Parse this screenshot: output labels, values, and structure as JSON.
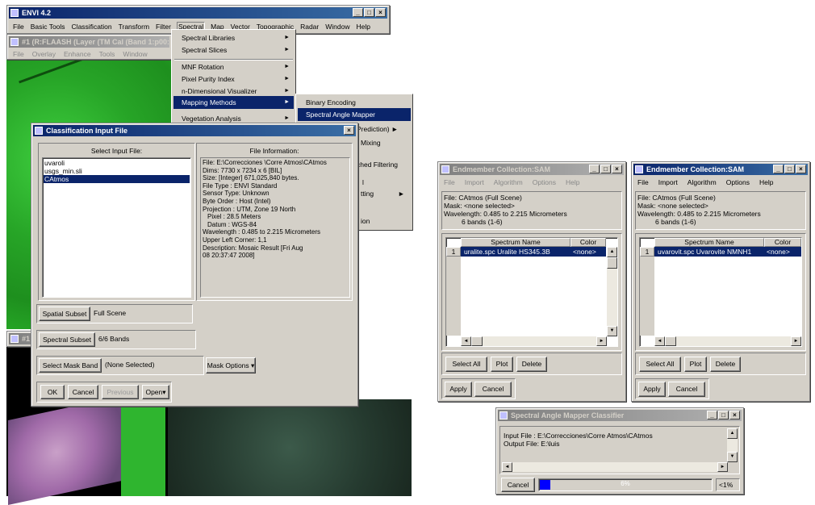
{
  "envi": {
    "title": "ENVI 4.2",
    "menu": [
      "File",
      "Basic Tools",
      "Classification",
      "Transform",
      "Filter",
      "Spectral",
      "Map",
      "Vector",
      "Topographic",
      "Radar",
      "Window",
      "Help"
    ],
    "active_menu": "Spectral"
  },
  "display1": {
    "title": "#1 (R:FLAASH (Layer (TM Cal (Band 1:p00:lo",
    "menu": [
      "File",
      "Overlay",
      "Enhance",
      "Tools",
      "Window"
    ]
  },
  "display2": {
    "title": "#1"
  },
  "spectral_menu": {
    "items": [
      {
        "label": "Spectral Libraries",
        "arrow": "►"
      },
      {
        "label": "Spectral Slices",
        "arrow": "►"
      },
      {
        "label": "MNF Rotation",
        "arrow": "►"
      },
      {
        "label": "Pixel Purity Index",
        "arrow": "►"
      },
      {
        "label": "n-Dimensional Visualizer",
        "arrow": "►"
      },
      {
        "label": "Mapping Methods",
        "arrow": "►"
      },
      {
        "label": "Vegetation Analysis",
        "arrow": "►"
      }
    ],
    "selected": "Mapping Methods"
  },
  "mapping_submenu": {
    "items": [
      {
        "label": "Binary Encoding"
      },
      {
        "label": "Spectral Angle Mapper"
      }
    ],
    "selected": "Spectral Angle Mapper",
    "partial_items": [
      "Prediction)",
      "Mixing",
      "ched Filtering",
      "l",
      "tting",
      "ion"
    ]
  },
  "classification_input": {
    "title": "Classification Input File",
    "select_label": "Select Input File:",
    "files": [
      "uvaroli",
      "usgs_min.sli",
      "CAtmos"
    ],
    "selected_file": "CAtmos",
    "info_label": "File Information:",
    "info_lines": [
      "File: E:\\Correcciones \\Corre Atmos\\CAtmos",
      "Dims: 7730 x 7234 x 6 [BIL]",
      "Size: [Integer] 671,025,840 bytes.",
      "File Type : ENVI Standard",
      "Sensor Type: Unknown",
      "Byte Order : Host (Intel)",
      "Projection : UTM, Zone 19 North",
      " Pixel    : 28.5 Meters",
      " Datum    : WGS-84",
      "Wavelength : 0.485 to 2.215 Micrometers",
      "Upper Left Corner: 1,1",
      "Description: Mosaic Result [Fri Aug",
      "08 20:37:47 2008]"
    ],
    "spatial_subset_button": "Spatial Subset",
    "spatial_subset_value": "Full Scene",
    "spectral_subset_button": "Spectral Subset",
    "spectral_subset_value": "6/6 Bands",
    "mask_band_button": "Select Mask Band",
    "mask_band_value": "(None Selected)",
    "mask_options_button": "Mask Options",
    "ok": "OK",
    "cancel": "Cancel",
    "previous": "Previous",
    "open": "Open"
  },
  "endmember1": {
    "title": "Endmember Collection:SAM",
    "menu": [
      "File",
      "Import",
      "Algorithm",
      "Options",
      "Help"
    ],
    "info": [
      "File: CAtmos (Full Scene)",
      "Mask: <none selected>",
      "Wavelength: 0.485 to 2.215 Micrometers",
      "6 bands (1-6)"
    ],
    "col_spectrum": "Spectrum Name",
    "col_color": "Color",
    "row_num": "1",
    "row_name": "uralite.spc Uralite HS345.3B",
    "row_color": "<none>",
    "select_all": "Select All",
    "plot": "Plot",
    "delete": "Delete",
    "apply": "Apply",
    "cancel": "Cancel"
  },
  "endmember2": {
    "title": "Endmember Collection:SAM",
    "menu": [
      "File",
      "Import",
      "Algorithm",
      "Options",
      "Help"
    ],
    "info": [
      "File: CAtmos (Full Scene)",
      "Mask: <none selected>",
      "Wavelength: 0.485 to 2.215 Micrometers",
      "6 bands (1-6)"
    ],
    "col_spectrum": "Spectrum Name",
    "col_color": "Color",
    "row_num": "1",
    "row_name": "uvarovit.spc Uvarovite NMNH1",
    "row_color": "<none>",
    "select_all": "Select All",
    "plot": "Plot",
    "delete": "Delete",
    "apply": "Apply",
    "cancel": "Cancel"
  },
  "sam_classifier": {
    "title": "Spectral Angle Mapper Classifier",
    "input_file": "Input File : E:\\Correcciones\\Corre Atmos\\CAtmos",
    "output_file": "Output File: E:\\luis",
    "cancel": "Cancel",
    "progress_text": "6%",
    "progress_fraction": 0.06,
    "status": "<1%"
  },
  "window_controls": {
    "minimize": "_",
    "maximize": "□",
    "close": "×"
  },
  "colors": {
    "titlebar": "#0a246a",
    "selection": "#0a246a",
    "vegetation": "#2fb52f",
    "progress": "#0000ff"
  }
}
